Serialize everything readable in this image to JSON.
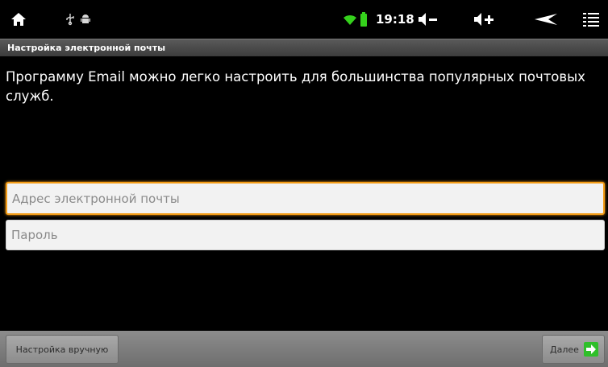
{
  "status_bar": {
    "time": "19:18",
    "icons": [
      "home-icon",
      "usb-icon",
      "android-debug-icon",
      "wifi-icon",
      "battery-icon",
      "volume-down-icon",
      "volume-up-icon",
      "back-icon",
      "menu-icon"
    ],
    "wifi_color": "#35d11c",
    "battery_color": "#35d11c"
  },
  "title_bar": {
    "title": "Настройка электронной почты"
  },
  "main": {
    "instruction": "Программу Email можно легко настроить для большинства популярных почтовых служб."
  },
  "form": {
    "email": {
      "value": "",
      "placeholder": "Адрес электронной почты"
    },
    "password": {
      "value": "",
      "placeholder": "Пароль"
    },
    "focus_color": "#f39c16"
  },
  "bottom_bar": {
    "manual_setup_label": "Настройка вручную",
    "next_label": "Далее",
    "next_icon": "arrow-right-icon",
    "next_icon_color": "#2fbf2a"
  }
}
